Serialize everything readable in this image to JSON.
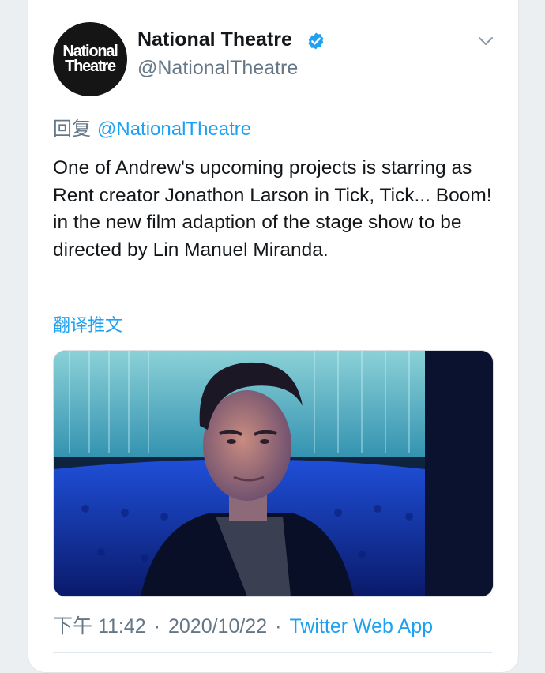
{
  "author": {
    "avatar_line1": "National",
    "avatar_line2": "Theatre",
    "display_name": "National Theatre",
    "handle": "@NationalTheatre",
    "verified": true,
    "verified_icon": "verified-badge-icon"
  },
  "menu_icon": "chevron-down-icon",
  "reply": {
    "prefix": "回复",
    "mention": "@NationalTheatre"
  },
  "tweet": {
    "text": "One of Andrew's upcoming projects is starring as Rent creator Jonathon Larson in Tick, Tick... Boom! in the new film adaption of the stage show to be directed by Lin Manuel Miranda.",
    "translate_label": "翻译推文"
  },
  "media": {
    "type": "photo"
  },
  "footer": {
    "time": "下午 11:42",
    "date": "2020/10/22",
    "separator": "·",
    "source": "Twitter Web App"
  },
  "colors": {
    "accent": "#1da1f2",
    "text": "#14171a",
    "secondary": "#657786"
  }
}
